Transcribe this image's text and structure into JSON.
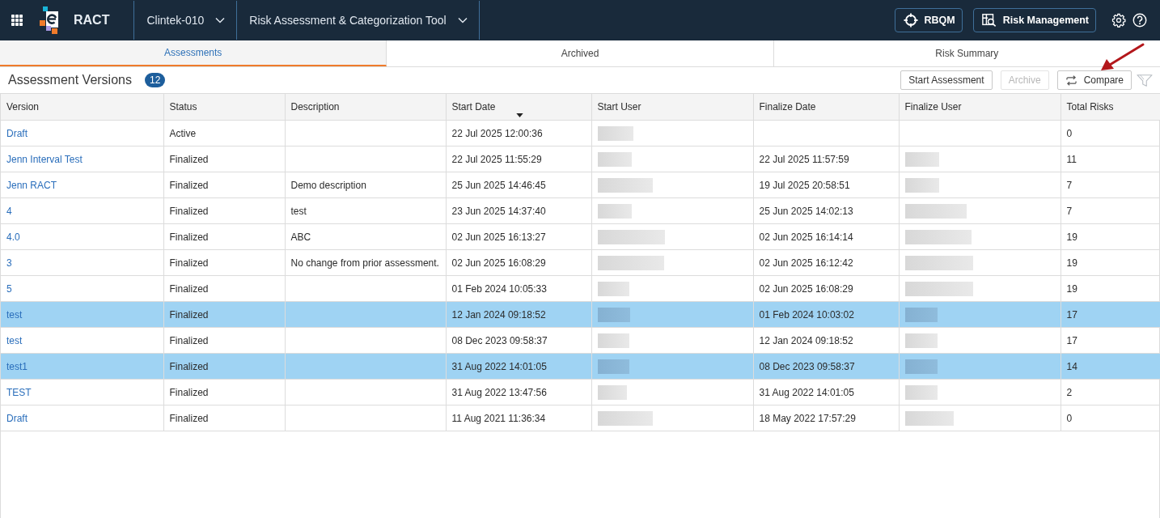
{
  "header": {
    "app_name": "RACT",
    "study": "Clintek-010",
    "tool": "Risk Assessment & Categorization Tool",
    "buttons": [
      {
        "label": "RBQM",
        "kind": "target"
      },
      {
        "label": "Risk Management",
        "kind": "search"
      }
    ]
  },
  "tabs": [
    {
      "label": "Assessments",
      "selected": true
    },
    {
      "label": "Archived",
      "selected": false
    },
    {
      "label": "Risk Summary",
      "selected": false
    }
  ],
  "toolbar": {
    "title": "Assessment Versions",
    "count": "12",
    "buttons": [
      {
        "label": "Start Assessment",
        "kind": "plain",
        "disabled": false
      },
      {
        "label": "Archive",
        "kind": "plain",
        "disabled": true
      },
      {
        "label": "Compare",
        "kind": "compare",
        "disabled": false
      }
    ]
  },
  "table": {
    "columns": [
      {
        "label": "Version",
        "sorted": false
      },
      {
        "label": "Status",
        "sorted": false
      },
      {
        "label": "Description",
        "sorted": false
      },
      {
        "label": "Start Date",
        "sorted": true
      },
      {
        "label": "Start User",
        "sorted": false
      },
      {
        "label": "Finalize Date",
        "sorted": false
      },
      {
        "label": "Finalize User",
        "sorted": false
      },
      {
        "label": "Total Risks",
        "sorted": false
      }
    ],
    "rows": [
      {
        "selected": false,
        "version": "Draft",
        "status": "Active",
        "start_date": "22 Jul 2025 12:00:36",
        "start_user_redacted": true,
        "finalize_user_redacted": false,
        "total_risks": "0"
      },
      {
        "selected": false,
        "version": "Jenn Interval Test",
        "status": "Finalized",
        "start_date": "22 Jul 2025 11:55:29",
        "start_user_redacted": true,
        "finalize_date": "22 Jul 2025 11:57:59",
        "finalize_user_redacted": true,
        "total_risks": "11"
      },
      {
        "selected": false,
        "version": "Jenn RACT",
        "status": "Finalized",
        "description": "Demo description",
        "start_date": "25 Jun 2025 14:46:45",
        "start_user_redacted": true,
        "finalize_date": "19 Jul 2025 20:58:51",
        "finalize_user_redacted": true,
        "total_risks": "7"
      },
      {
        "selected": false,
        "version": "4",
        "status": "Finalized",
        "description": "test",
        "start_date": "23 Jun 2025 14:37:40",
        "start_user_redacted": true,
        "finalize_date": "25 Jun 2025 14:02:13",
        "finalize_user_redacted": true,
        "total_risks": "7"
      },
      {
        "selected": false,
        "version": "4.0",
        "status": "Finalized",
        "description": "ABC",
        "start_date": "02 Jun 2025 16:13:27",
        "start_user_redacted": true,
        "finalize_date": "02 Jun 2025 16:14:14",
        "finalize_user_redacted": true,
        "total_risks": "19"
      },
      {
        "selected": false,
        "version": "3",
        "status": "Finalized",
        "description": "No change from prior assessment.",
        "start_date": "02 Jun 2025 16:08:29",
        "start_user_redacted": true,
        "finalize_date": "02 Jun 2025 16:12:42",
        "finalize_user_redacted": true,
        "total_risks": "19"
      },
      {
        "selected": false,
        "version": "5",
        "status": "Finalized",
        "start_date": "01 Feb 2024 10:05:33",
        "start_user_redacted": true,
        "finalize_date": "02 Jun 2025 16:08:29",
        "finalize_user_redacted": true,
        "total_risks": "19"
      },
      {
        "selected": true,
        "version": "test",
        "status": "Finalized",
        "start_date": "12 Jan 2024 09:18:52",
        "start_user_redacted": true,
        "finalize_date": "01 Feb 2024 10:03:02",
        "finalize_user_redacted": true,
        "total_risks": "17"
      },
      {
        "selected": false,
        "version": "test",
        "status": "Finalized",
        "start_date": "08 Dec 2023 09:58:37",
        "start_user_redacted": true,
        "finalize_date": "12 Jan 2024 09:18:52",
        "finalize_user_redacted": true,
        "total_risks": "17"
      },
      {
        "selected": true,
        "version": "test1",
        "status": "Finalized",
        "start_date": "31 Aug 2022 14:01:05",
        "start_user_redacted": true,
        "finalize_date": "08 Dec 2023 09:58:37",
        "finalize_user_redacted": true,
        "total_risks": "14"
      },
      {
        "selected": false,
        "version": "TEST",
        "status": "Finalized",
        "start_date": "31 Aug 2022 13:47:56",
        "start_user_redacted": true,
        "finalize_date": "31 Aug 2022 14:01:05",
        "finalize_user_redacted": true,
        "total_risks": "2"
      },
      {
        "selected": false,
        "version": "Draft",
        "status": "Finalized",
        "start_date": "11 Aug 2021 11:36:34",
        "start_user_redacted": true,
        "finalize_date": "18 May 2022 17:57:29",
        "finalize_user_redacted": true,
        "total_risks": "0"
      }
    ]
  }
}
